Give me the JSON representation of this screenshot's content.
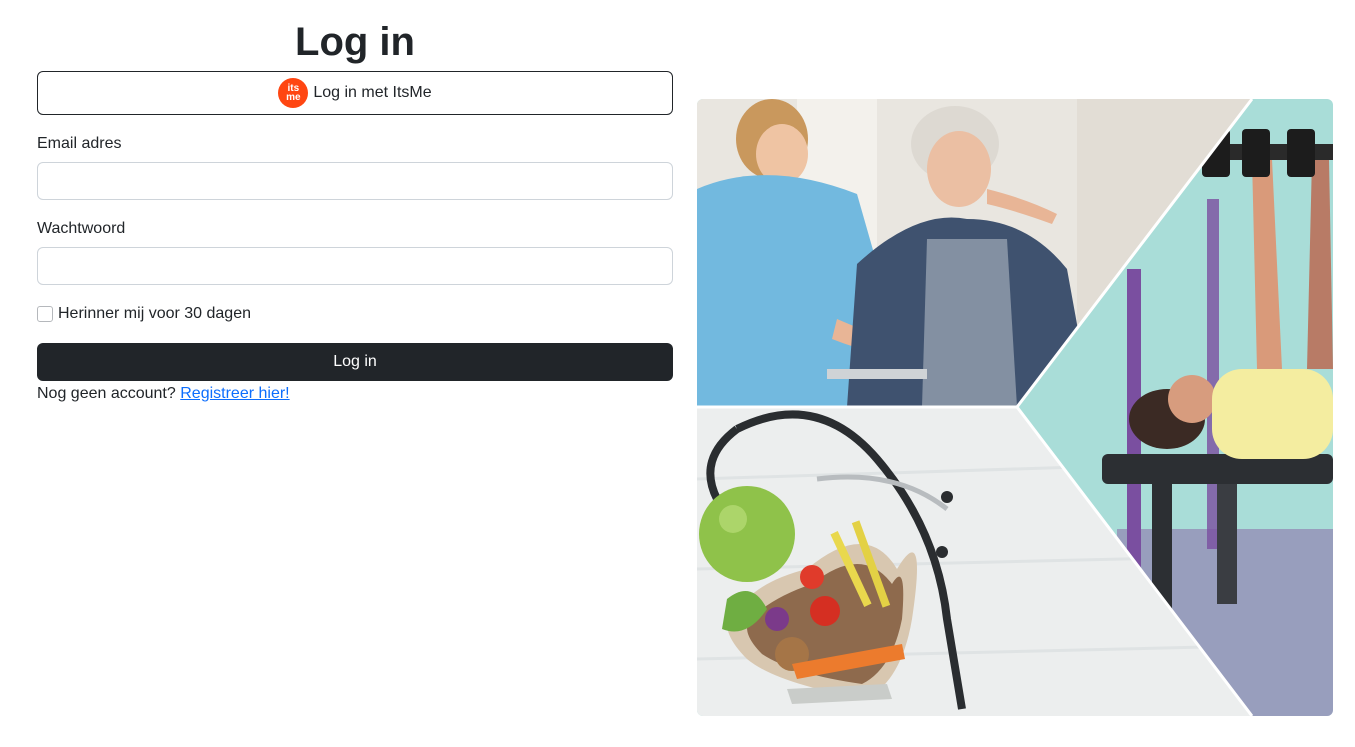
{
  "page": {
    "title": "Log in"
  },
  "itsme": {
    "logo_text_top": "its",
    "logo_text_bottom": "me",
    "label": "Log in met ItsMe",
    "brand_color": "#ff4612"
  },
  "form": {
    "email_label": "Email adres",
    "email_value": "",
    "password_label": "Wachtwoord",
    "password_value": "",
    "remember_label": "Herinner mij voor 30 dagen",
    "remember_checked": false,
    "submit_label": "Log in"
  },
  "register": {
    "prompt": "Nog geen account?",
    "link_label": "Registreer hier!"
  },
  "colors": {
    "primary_dark": "#212529",
    "link": "#0d6efd"
  },
  "hero": {
    "panels": [
      "physiotherapy-nurse-elderly",
      "woman-lifting-dumbbells",
      "healthy-food-stethoscope"
    ]
  }
}
